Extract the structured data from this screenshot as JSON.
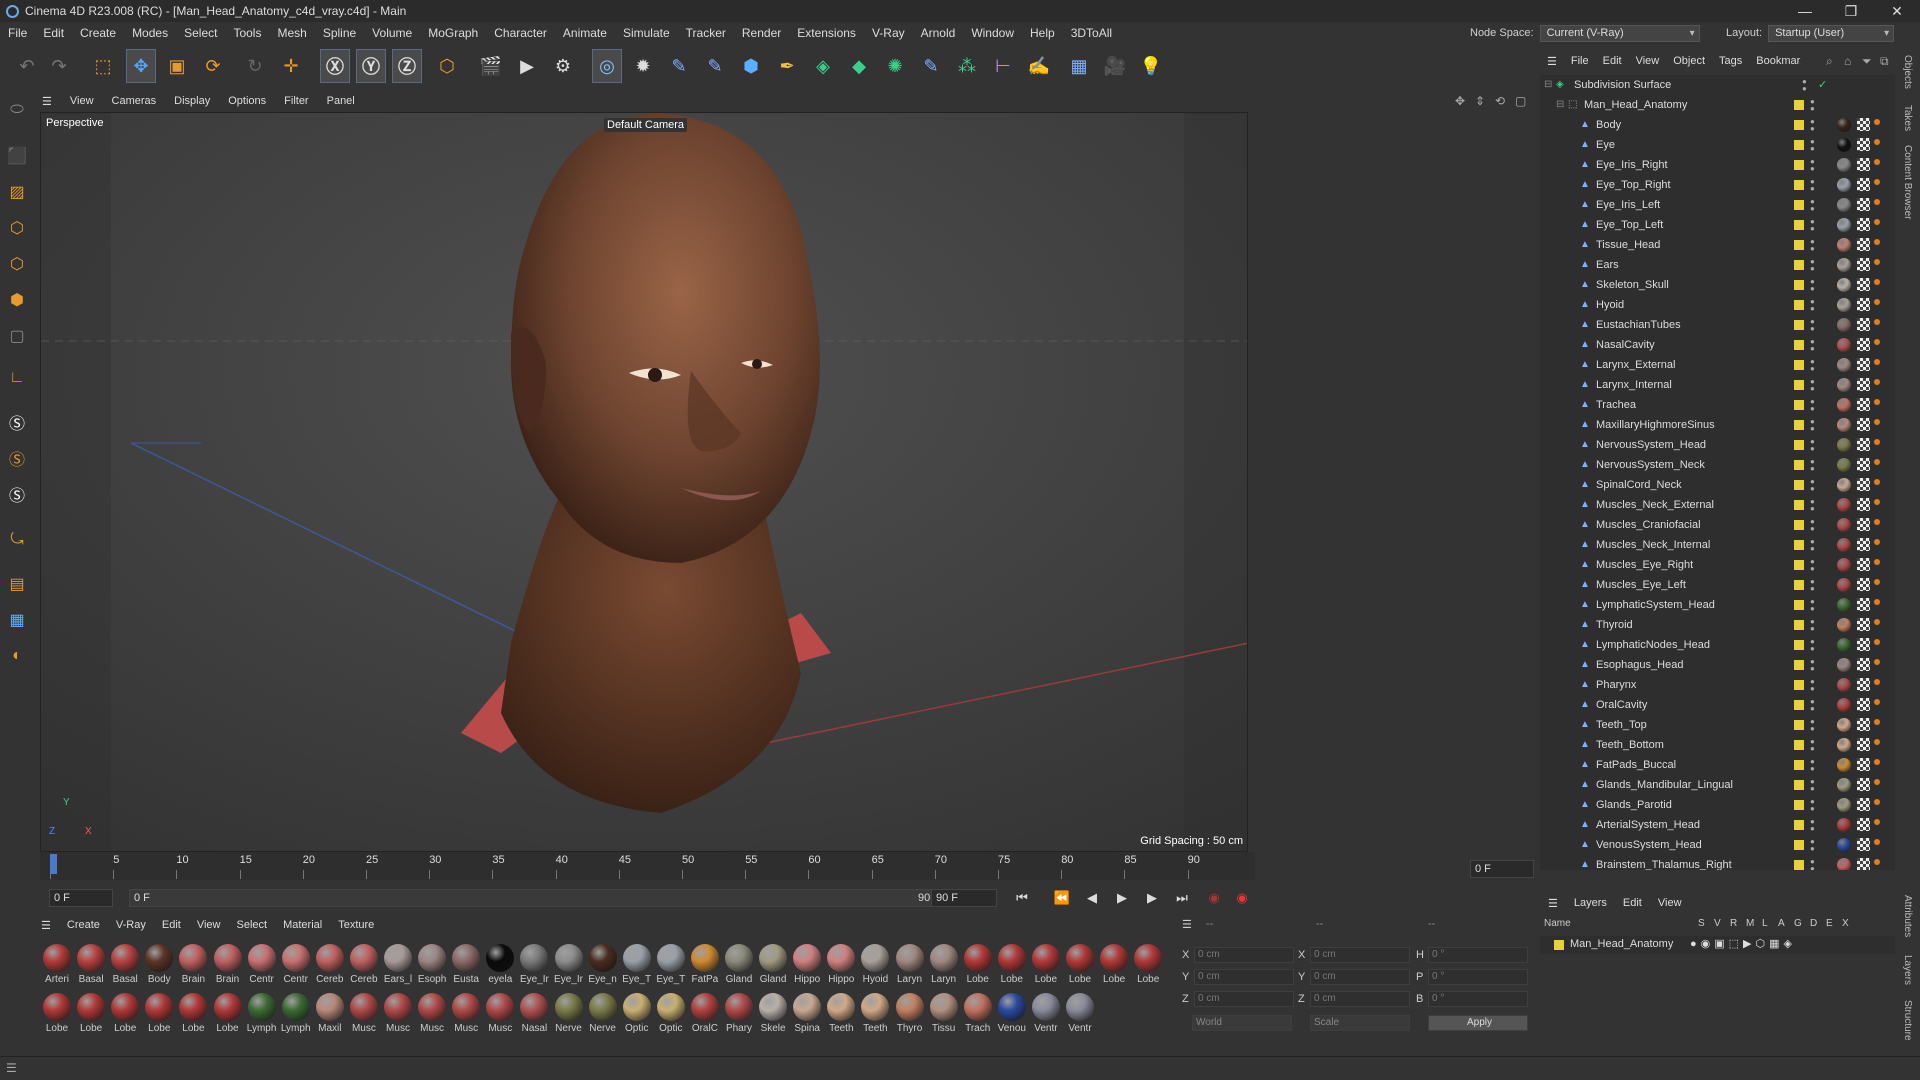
{
  "app": {
    "title": "Cinema 4D R23.008 (RC) - [Man_Head_Anatomy_c4d_vray.c4d] - Main"
  },
  "menubar": {
    "items": [
      "File",
      "Edit",
      "Create",
      "Modes",
      "Select",
      "Tools",
      "Mesh",
      "Spline",
      "Volume",
      "MoGraph",
      "Character",
      "Animate",
      "Simulate",
      "Tracker",
      "Render",
      "Extensions",
      "V-Ray",
      "Arnold",
      "Window",
      "Help",
      "3DToAll"
    ],
    "node_space_label": "Node Space:",
    "node_space_value": "Current (V-Ray)",
    "layout_label": "Layout:",
    "layout_value": "Startup (User)"
  },
  "viewport": {
    "menu": [
      "View",
      "Cameras",
      "Display",
      "Options",
      "Filter",
      "Panel"
    ],
    "label": "Perspective",
    "camera": "Default Camera",
    "grid_spacing": "Grid Spacing : 50 cm"
  },
  "timeline": {
    "ticks": [
      "0",
      "5",
      "10",
      "15",
      "20",
      "25",
      "30",
      "35",
      "40",
      "45",
      "50",
      "55",
      "60",
      "65",
      "70",
      "75",
      "80",
      "85",
      "90"
    ],
    "current_frame": "0 F"
  },
  "transport": {
    "start": "0 F",
    "range_start": "0 F",
    "range_end": "90 F",
    "end": "90 F"
  },
  "materials": {
    "menu": [
      "Create",
      "V-Ray",
      "Edit",
      "View",
      "Select",
      "Material",
      "Texture"
    ],
    "row1": [
      [
        "Arteri",
        "#b23a3a"
      ],
      [
        "Basal",
        "#b84040"
      ],
      [
        "Basal",
        "#b84040"
      ],
      [
        "Body",
        "#5a3526"
      ],
      [
        "Brain",
        "#c06060"
      ],
      [
        "Brain",
        "#c06060"
      ],
      [
        "Centr",
        "#c87070"
      ],
      [
        "Centr",
        "#c87070"
      ],
      [
        "Cereb",
        "#c06060"
      ],
      [
        "Cereb",
        "#c06060"
      ],
      [
        "Ears_l",
        "#a89a98"
      ],
      [
        "Esoph",
        "#9c8482"
      ],
      [
        "Eusta",
        "#8a6a66"
      ],
      [
        "eyela",
        "#0a0a0a"
      ],
      [
        "Eye_Ir",
        "#7a7a7a"
      ],
      [
        "Eye_Ir",
        "#8c8c8c"
      ],
      [
        "Eye_n",
        "#4a2c20"
      ],
      [
        "Eye_T",
        "#9aa0a8"
      ],
      [
        "Eye_T",
        "#9aa0a8"
      ],
      [
        "FatPa",
        "#d08a30"
      ],
      [
        "Gland",
        "#8a8a7a"
      ],
      [
        "Gland",
        "#a09a80"
      ],
      [
        "Hippo",
        "#d08080"
      ],
      [
        "Hippo",
        "#d08080"
      ],
      [
        "Hyoid",
        "#a8a098"
      ],
      [
        "Laryn",
        "#a08880"
      ],
      [
        "Laryn",
        "#a08880"
      ],
      [
        "Lobe",
        "#b03838"
      ],
      [
        "Lobe",
        "#b03838"
      ],
      [
        "Lobe",
        "#b03838"
      ],
      [
        "Lobe",
        "#b03838"
      ],
      [
        "Lobe",
        "#b03838"
      ],
      [
        "Lobe",
        "#b03838"
      ]
    ],
    "row2": [
      [
        "Lobe",
        "#b03838"
      ],
      [
        "Lobe",
        "#b03838"
      ],
      [
        "Lobe",
        "#b03838"
      ],
      [
        "Lobe",
        "#b03838"
      ],
      [
        "Lobe",
        "#b03838"
      ],
      [
        "Lobe",
        "#b03838"
      ],
      [
        "Lymph",
        "#3c6a32"
      ],
      [
        "Lymph",
        "#3c6a32"
      ],
      [
        "Maxil",
        "#b88878"
      ],
      [
        "Musc",
        "#b04848"
      ],
      [
        "Musc",
        "#b04848"
      ],
      [
        "Musc",
        "#b04848"
      ],
      [
        "Musc",
        "#b04848"
      ],
      [
        "Musc",
        "#b04848"
      ],
      [
        "Nasal",
        "#b05050"
      ],
      [
        "Nerve",
        "#7a7a48"
      ],
      [
        "Nerve",
        "#7a7a48"
      ],
      [
        "Optic",
        "#c8b070"
      ],
      [
        "Optic",
        "#c8b070"
      ],
      [
        "OralC",
        "#b04040"
      ],
      [
        "Phary",
        "#b04848"
      ],
      [
        "Skele",
        "#b8b0a8"
      ],
      [
        "Spina",
        "#c8a890"
      ],
      [
        "Teeth",
        "#d0a888"
      ],
      [
        "Teeth",
        "#d0a888"
      ],
      [
        "Thyro",
        "#c08060"
      ],
      [
        "Tissu",
        "#b09080"
      ],
      [
        "Trach",
        "#c07060"
      ],
      [
        "Venou",
        "#2a4aa0"
      ],
      [
        "Ventr",
        "#8a8a9a"
      ],
      [
        "Ventr",
        "#8a8a9a"
      ]
    ]
  },
  "coords": {
    "x": "X",
    "y": "Y",
    "z": "Z",
    "h": "H",
    "p": "P",
    "b": "B",
    "val_cm": "0 cm",
    "val_deg": "0 °",
    "world": "World",
    "scale": "Scale",
    "apply": "Apply",
    "dashes": "--"
  },
  "objects": {
    "menu": [
      "File",
      "Edit",
      "View",
      "Object",
      "Tags",
      "Bookmar"
    ],
    "root": "Subdivision Surface",
    "group": "Man_Head_Anatomy",
    "items": [
      [
        "Body",
        "#3a2418"
      ],
      [
        "Eye",
        "#111"
      ],
      [
        "Eye_Iris_Right",
        "#888"
      ],
      [
        "Eye_Top_Right",
        "#9aa0a8"
      ],
      [
        "Eye_Iris_Left",
        "#888"
      ],
      [
        "Eye_Top_Left",
        "#9aa0a8"
      ],
      [
        "Tissue_Head",
        "#c08070"
      ],
      [
        "Ears",
        "#aaa098"
      ],
      [
        "Skeleton_Skull",
        "#b8b0a8"
      ],
      [
        "Hyoid",
        "#a8a098"
      ],
      [
        "EustachianTubes",
        "#8a6a66"
      ],
      [
        "NasalCavity",
        "#b05050"
      ],
      [
        "Larynx_External",
        "#a08880"
      ],
      [
        "Larynx_Internal",
        "#a08880"
      ],
      [
        "Trachea",
        "#c07060"
      ],
      [
        "MaxillaryHighmoreSinus",
        "#b88878"
      ],
      [
        "NervousSystem_Head",
        "#7a7a48"
      ],
      [
        "NervousSystem_Neck",
        "#7a7a48"
      ],
      [
        "SpinalCord_Neck",
        "#c8a890"
      ],
      [
        "Muscles_Neck_External",
        "#b04848"
      ],
      [
        "Muscles_Craniofacial",
        "#b04848"
      ],
      [
        "Muscles_Neck_Internal",
        "#b04848"
      ],
      [
        "Muscles_Eye_Right",
        "#b04848"
      ],
      [
        "Muscles_Eye_Left",
        "#b04848"
      ],
      [
        "LymphaticSystem_Head",
        "#3c6a32"
      ],
      [
        "Thyroid",
        "#c08060"
      ],
      [
        "LymphaticNodes_Head",
        "#3c6a32"
      ],
      [
        "Esophagus_Head",
        "#9c8482"
      ],
      [
        "Pharynx",
        "#b04848"
      ],
      [
        "OralCavity",
        "#b04040"
      ],
      [
        "Teeth_Top",
        "#d0a888"
      ],
      [
        "Teeth_Bottom",
        "#d0a888"
      ],
      [
        "FatPads_Buccal",
        "#d08a30"
      ],
      [
        "Glands_Mandibular_Lingual",
        "#a09a80"
      ],
      [
        "Glands_Parotid",
        "#a09a80"
      ],
      [
        "ArterialSystem_Head",
        "#b23a3a"
      ],
      [
        "VenousSystem_Head",
        "#2a4aa0"
      ],
      [
        "Brainstem_Thalamus_Right",
        "#c06060"
      ]
    ]
  },
  "layers": {
    "menu": [
      "Layers",
      "Edit",
      "View"
    ],
    "name_col": "Name",
    "cols": [
      "S",
      "V",
      "R",
      "M",
      "L",
      "A",
      "G",
      "D",
      "E",
      "X"
    ],
    "row": "Man_Head_Anatomy"
  },
  "side_tabs": [
    "Objects",
    "Takes",
    "Content Browser",
    "Attributes",
    "Layers",
    "Structure"
  ]
}
